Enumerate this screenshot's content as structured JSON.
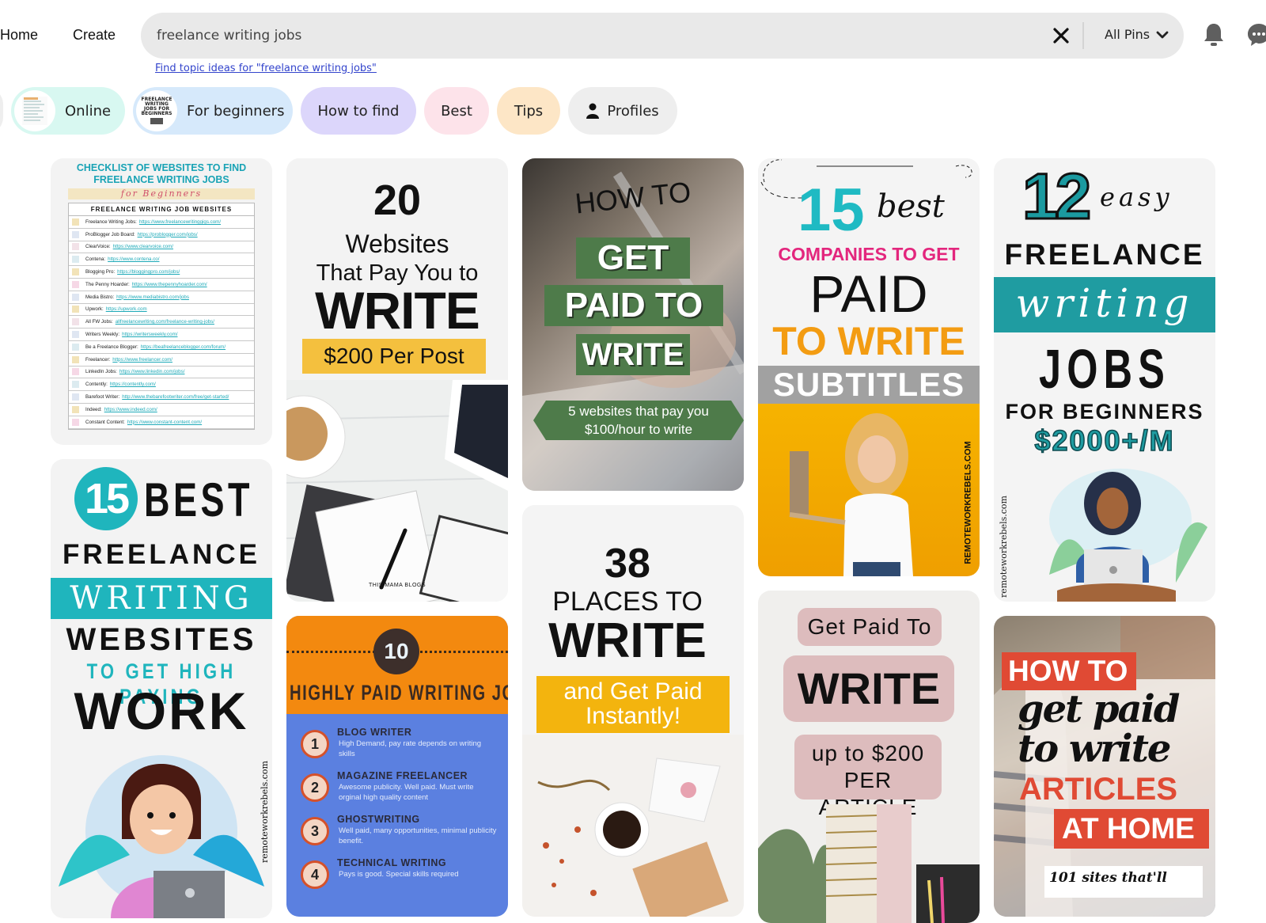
{
  "nav": {
    "home": "Home",
    "create": "Create"
  },
  "search": {
    "value": "freelance writing jobs",
    "scope": "All Pins",
    "topic_link": "Find topic ideas for \"freelance writing jobs\""
  },
  "icons": {
    "clear": "close-icon",
    "chevron": "chevron-down-icon",
    "bell": "bell-icon",
    "chat": "chat-icon",
    "person": "person-icon"
  },
  "chips": [
    {
      "label": "Online",
      "color": "#d8f8f1"
    },
    {
      "label": "For beginners",
      "color": "#d6e9fb"
    },
    {
      "label": "How to find",
      "color": "#dcd6fb"
    },
    {
      "label": "Best",
      "color": "#fde3ea"
    },
    {
      "label": "Tips",
      "color": "#fde6c6"
    },
    {
      "label": "Profiles",
      "color": "#eeeeee"
    }
  ],
  "chip_thumb_beginners": [
    "FREELANCE",
    "WRITING",
    "JOBS FOR",
    "BEGINNERS"
  ],
  "pins": {
    "checklist": {
      "title1": "CHECKLIST OF WEBSITES TO FIND",
      "title2": "FREELANCE WRITING JOBS",
      "subtitle": "for Beginners",
      "table_header": "FREELANCE WRITING JOB WEBSITES",
      "rows": [
        {
          "name": "Freelance Writing Jobs:",
          "url": "https://www.freelancewritinggigs.com/",
          "color": "#f2e3b8"
        },
        {
          "name": "ProBlogger Job Board:",
          "url": "https://problogger.com/jobs/",
          "color": "#dfe6f2"
        },
        {
          "name": "ClearVoice:",
          "url": "https://www.clearvoice.com/",
          "color": "#f2e2e8"
        },
        {
          "name": "Contena:",
          "url": "https://www.contena.co/",
          "color": "#dcebf0"
        },
        {
          "name": "Blogging Pro:",
          "url": "https://bloggingpro.com/jobs/",
          "color": "#f2e3b8"
        },
        {
          "name": "The Penny Hoarder:",
          "url": "https://www.thepennyhoarder.com/",
          "color": "#f6d8e6"
        },
        {
          "name": "Media Bistro:",
          "url": "https://www.mediabistro.com/jobs",
          "color": "#dfe6f2"
        },
        {
          "name": "Upwork:",
          "url": "https://upwork.com",
          "color": "#f2e3b8"
        },
        {
          "name": "All FW Jobs:",
          "url": "allfreelancewriting.com/freelance-writing-jobs/",
          "color": "#f2e2e8"
        },
        {
          "name": "Writers Weekly:",
          "url": "https://writersweekly.com/",
          "color": "#dfe6f2"
        },
        {
          "name": "Be a Freelance Blogger:",
          "url": "https://beafreelanceblogger.com/forum/",
          "color": "#dcebf0"
        },
        {
          "name": "Freelancer:",
          "url": "https://www.freelancer.com/",
          "color": "#f2e3b8"
        },
        {
          "name": "LinkedIn Jobs:",
          "url": "https://www.linkedin.com/jobs/",
          "color": "#f6d8e6"
        },
        {
          "name": "Contently:",
          "url": "https://contently.com/",
          "color": "#dcebf0"
        },
        {
          "name": "Barefoot Writer:",
          "url": "http://www.thebarefootwriter.com/free/get-started/",
          "color": "#dfe6f2"
        },
        {
          "name": "Indeed:",
          "url": "https://www.indeed.com/",
          "color": "#f2e3b8"
        },
        {
          "name": "Constant Content:",
          "url": "https://www.constant-content.com/",
          "color": "#f6d8e6"
        }
      ]
    },
    "twenty": {
      "num": "20",
      "line1": "Websites",
      "line2": "That Pay You to",
      "line3": "WRITE",
      "banner": "$200 Per Post",
      "credit": "THIS MAMA BLOGS"
    },
    "howto": {
      "how": "HOW TO",
      "l1": "GET",
      "l2": "PAID TO",
      "l3": "WRITE",
      "ribbon1": "5 websites that pay you",
      "ribbon2": "$100/hour to write"
    },
    "fifteen_sub": {
      "num": "15",
      "best": "best",
      "l1": "COMPANIES TO GET",
      "l2": "PAID",
      "l3": "TO WRITE",
      "l4": "SUBTITLES",
      "credit": "REMOTEWORKREBELS.COM"
    },
    "twelve": {
      "num": "12",
      "easy": "easy",
      "l1": "FREELANCE",
      "l2": "writing",
      "l3": "JOBS",
      "l4": "FOR BEGINNERS",
      "l5": "$2000+/M",
      "credit": "remoteworkrebels.com"
    },
    "fifteen_best": {
      "num": "15",
      "best": "BEST",
      "l1": "FREELANCE",
      "l2": "WRITING",
      "l3": "WEBSITES",
      "l4": "TO GET HIGH PAYING",
      "l5": "WORK",
      "credit": "remoteworkrebels.com"
    },
    "ten": {
      "num": "10",
      "title": "HIGHLY PAID WRITING JOBS",
      "items": [
        {
          "n": "1",
          "title": "BLOG WRITER",
          "desc": "High Demand, pay rate depends on writing skills"
        },
        {
          "n": "2",
          "title": "MAGAZINE FREELANCER",
          "desc": "Awesome publicity. Well paid.  Must write orginal high quality content"
        },
        {
          "n": "3",
          "title": "GHOSTWRITING",
          "desc": "Well paid, many opportunities, minimal publicity benefit."
        },
        {
          "n": "4",
          "title": "TECHNICAL WRITING",
          "desc": "Pays is good.  Special skills required"
        }
      ]
    },
    "thirtyeight": {
      "num": "38",
      "l1": "PLACES TO",
      "l2": "WRITE",
      "banner1": "and Get Paid",
      "banner2": "Instantly!"
    },
    "getpaid": {
      "l1": "Get Paid To",
      "l2": "WRITE",
      "l3": "up to $200",
      "l4": "PER ARTICLE"
    },
    "articles": {
      "l1": "HOW TO",
      "l2": "get paid",
      "l3": "to write",
      "l4": "ARTICLES",
      "l5": "AT HOME",
      "l6": "101 sites that'll"
    }
  }
}
